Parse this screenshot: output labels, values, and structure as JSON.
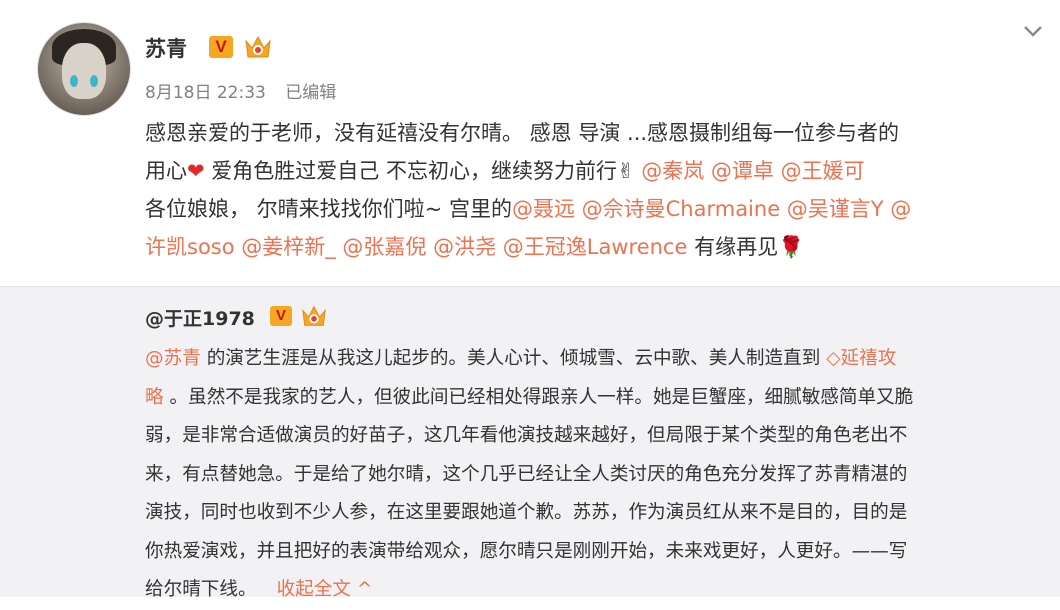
{
  "post": {
    "author": "苏青",
    "badge_v": "V",
    "timestamp": "8月18日 22:33",
    "edited": "已编辑",
    "content_lines": [
      [
        {
          "t": "感恩亲爱的于老师，没有延禧没有尔晴。 感恩 导演 ...感恩摄制组每一位参与者的",
          "type": "text"
        }
      ],
      [
        {
          "t": "用心",
          "type": "text"
        },
        {
          "t": "❤",
          "type": "heart"
        },
        {
          "t": " 爱角色胜过爱自己 不忘初心，继续努力前行",
          "type": "text"
        },
        {
          "t": "✌",
          "type": "emoji"
        },
        {
          "t": " @秦岚 @谭卓 @王媛可",
          "type": "mention"
        }
      ],
      [
        {
          "t": "各位娘娘， 尔晴来找找你们啦~ 宫里的",
          "type": "text"
        },
        {
          "t": "@聂远 @佘诗曼Charmaine @吴谨言Y @",
          "type": "mention"
        }
      ],
      [
        {
          "t": "许凯soso @姜梓新_ @张嘉倪 @洪尧 @王冠逸Lawrence",
          "type": "mention"
        },
        {
          "t": " 有缘再见",
          "type": "text"
        },
        {
          "t": "🌹",
          "type": "emoji"
        }
      ]
    ]
  },
  "repost": {
    "author": "@于正1978",
    "badge_v": "V",
    "lines": [
      [
        {
          "t": "@苏青",
          "type": "mention"
        },
        {
          "t": " 的演艺生涯是从我这儿起步的。美人心计、倾城雪、云中歌、美人制造直到 ",
          "type": "text"
        },
        {
          "t": "◇延禧攻",
          "type": "mention"
        }
      ],
      [
        {
          "t": "略",
          "type": "mention"
        },
        {
          "t": " 。虽然不是我家的艺人，但彼此间已经相处得跟亲人一样。她是巨蟹座，细腻敏感简单又脆",
          "type": "text"
        }
      ],
      [
        {
          "t": "弱，是非常合适做演员的好苗子，这几年看他演技越来越好，但局限于某个类型的角色老出不",
          "type": "text"
        }
      ],
      [
        {
          "t": "来，有点替她急。于是给了她尔晴，这个几乎已经让全人类讨厌的角色充分发挥了苏青精湛的",
          "type": "text"
        }
      ],
      [
        {
          "t": "演技，同时也收到不少人参，在这里要跟她道个歉。苏苏，作为演员红从来不是目的，目的是",
          "type": "text"
        }
      ],
      [
        {
          "t": "你热爱演戏，并且把好的表演带给观众，愿尔晴只是刚刚开始，未来戏更好，人更好。——写",
          "type": "text"
        }
      ],
      [
        {
          "t": "给尔晴下线。",
          "type": "text"
        }
      ]
    ],
    "collapse_label": "收起全文 ^"
  },
  "icons": {
    "vip": "vip-v-badge",
    "crown": "member-crown-icon",
    "chevron": "chevron-down-icon",
    "avatar": "user-avatar"
  },
  "colors": {
    "mention": "#eb7350",
    "repost_bg": "#f2f2f5",
    "badge": "#f5a623"
  }
}
